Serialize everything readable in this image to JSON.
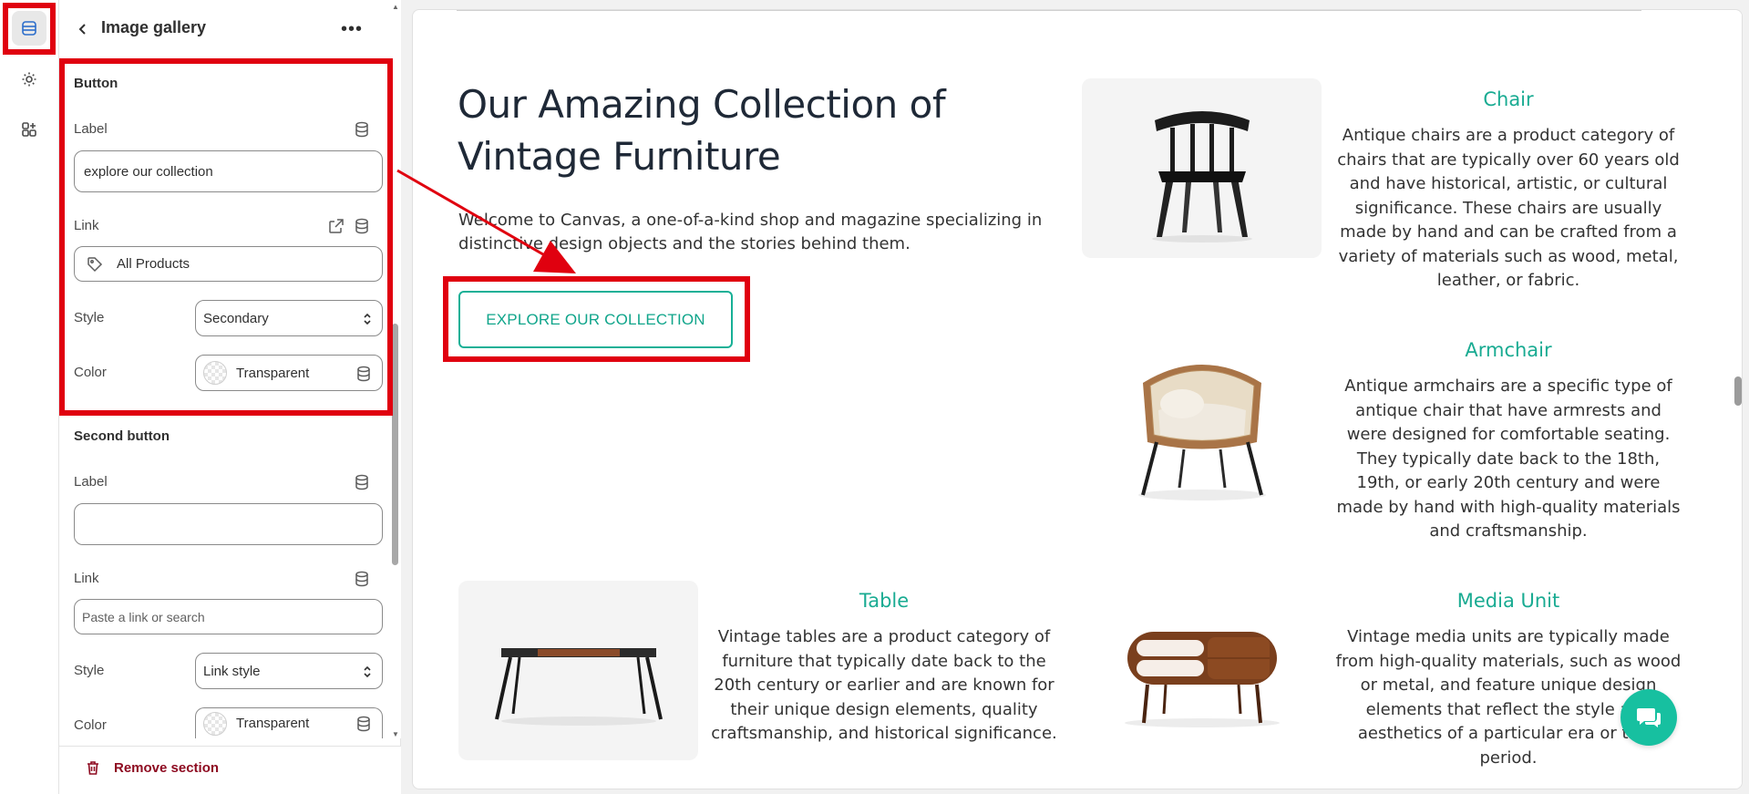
{
  "rail": {
    "items": [
      {
        "name": "sections-icon"
      },
      {
        "name": "settings-icon"
      },
      {
        "name": "apps-icon"
      }
    ]
  },
  "panel": {
    "title": "Image gallery",
    "more": "•••",
    "button_section": {
      "title": "Button",
      "label_caption": "Label",
      "label_value": "explore our collection",
      "link_caption": "Link",
      "link_value": "All Products",
      "style_caption": "Style",
      "style_value": "Secondary",
      "color_caption": "Color",
      "color_value": "Transparent"
    },
    "second_button_section": {
      "title": "Second button",
      "label_caption": "Label",
      "label_value": "",
      "link_caption": "Link",
      "link_placeholder": "Paste a link or search",
      "style_caption": "Style",
      "style_value": "Link style",
      "color_caption": "Color",
      "color_value": "Transparent"
    },
    "remove_label": "Remove section"
  },
  "preview": {
    "heading": "Our Amazing Collection of Vintage Furniture",
    "intro": "Welcome to Canvas, a one-of-a-kind shop and magazine specializing in distinctive design objects and the stories behind them.",
    "cta_label": "EXPLORE OUR COLLECTION",
    "accent_color": "#17b096",
    "features": [
      {
        "title": "Chair",
        "text": "Antique chairs are a product category of chairs that are typically over 60 years old and have historical, artistic, or cultural significance. These chairs are usually made by hand and can be crafted from a variety of materials such as wood, metal, leather, or fabric."
      },
      {
        "title": "Armchair",
        "text": "Antique armchairs are a specific type of antique chair that have armrests and were designed for comfortable seating. They typically date back to the 18th, 19th, or early 20th century and were made by hand with high-quality materials and craftsmanship."
      },
      {
        "title": "Table",
        "text": "Vintage tables are a product category of furniture that typically date back to the 20th century or earlier and are known for their unique design elements, quality craftsmanship, and historical significance."
      },
      {
        "title": "Media Unit",
        "text": "Vintage media units are typically made from high-quality materials, such as wood or metal, and feature unique design elements that reflect the style and aesthetics of a particular era or time period."
      }
    ]
  },
  "annotation_color": "#e0000f"
}
